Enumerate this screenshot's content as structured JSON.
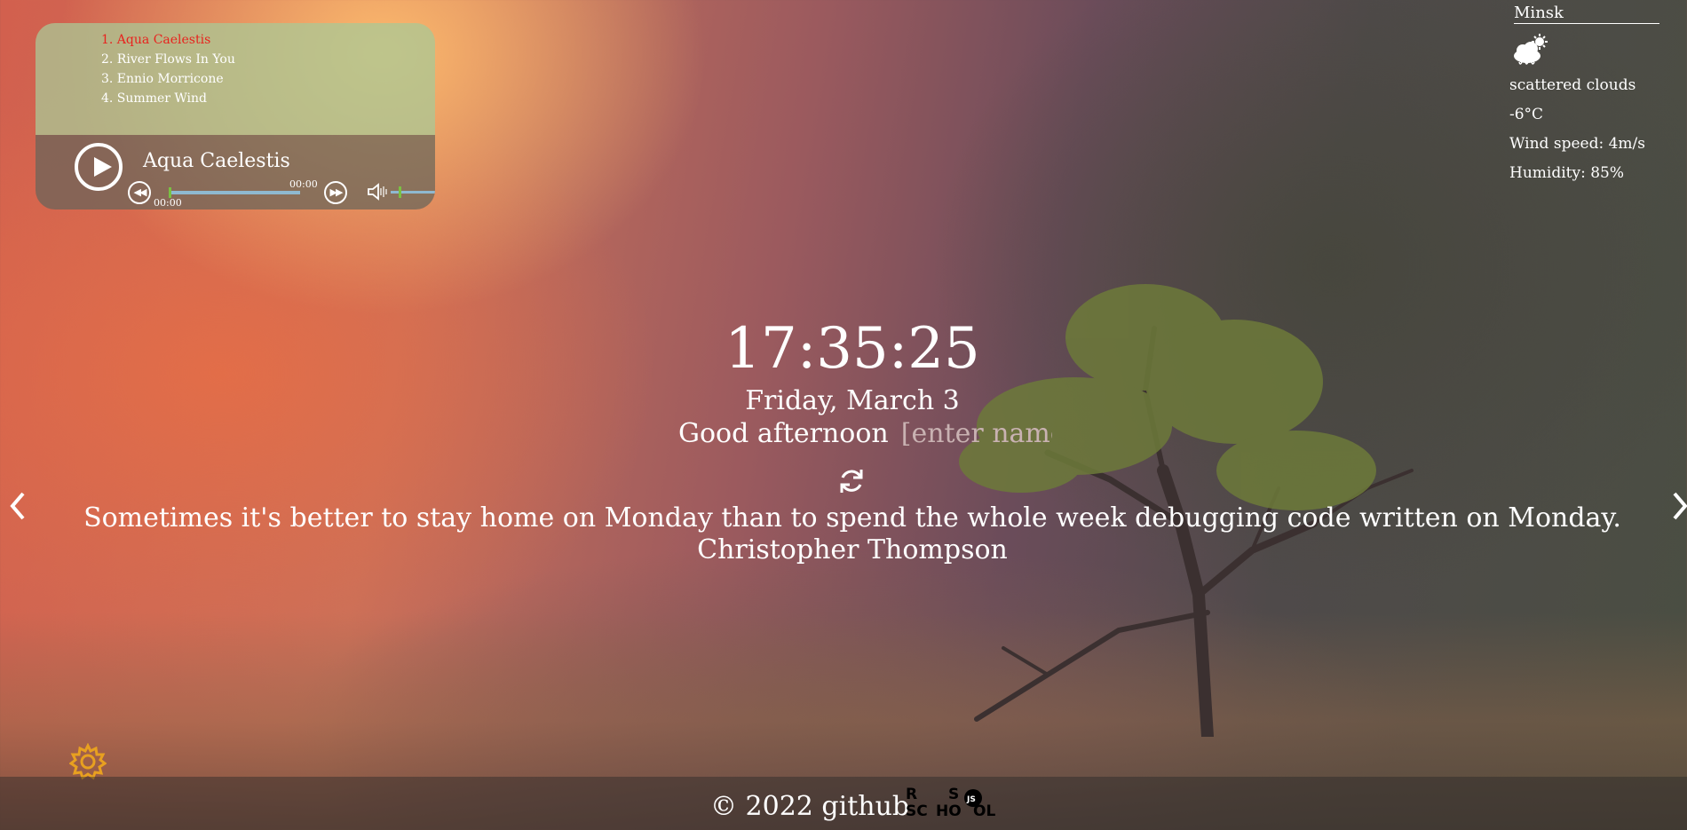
{
  "player": {
    "playlist": [
      "1. Aqua Caelestis",
      "2. River Flows In You",
      "3. Ennio Morricone",
      "4. Summer Wind"
    ],
    "active_index": 0,
    "now_playing": "Aqua Caelestis",
    "current_time": "00:00",
    "duration": "00:00",
    "progress": 0,
    "volume": 0.2,
    "icons": {
      "play": "play-icon",
      "prev": "rewind-icon",
      "next": "fast-forward-icon",
      "volume": "speaker-icon"
    }
  },
  "weather": {
    "city": "Minsk",
    "icon": "cloud-sun-icon",
    "description": "scattered clouds",
    "temperature": "-6°C",
    "wind": "Wind speed: 4m/s",
    "humidity": "Humidity: 85%"
  },
  "clock": {
    "time": "17:35:25",
    "date": "Friday, March 3",
    "greeting": "Good afternoon",
    "name_placeholder": "[enter name]"
  },
  "quote": {
    "text": "Sometimes it's better to stay home on Monday than to spend the whole week debugging code written on Monday.",
    "author": "Christopher Thompson"
  },
  "footer": {
    "copyright": "© 2022 github",
    "school_logo": "RS School JS"
  },
  "colors": {
    "active_track": "#e8231e",
    "progress_fill": "#7ac143",
    "progress_track": "#8fb9d0",
    "settings_icon": "#e8a020"
  }
}
